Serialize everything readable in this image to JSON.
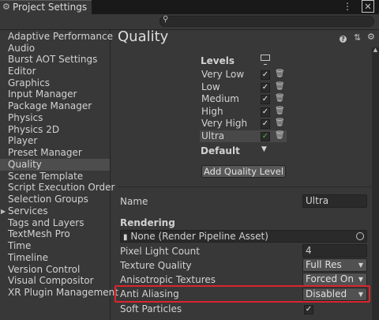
{
  "window": {
    "title": "Project Settings",
    "icons": [
      "gear-icon",
      "kebab-menu-icon",
      "close-icon"
    ]
  },
  "search": {
    "placeholder": "",
    "icon": "search-icon"
  },
  "sidebar": {
    "items": [
      {
        "label": "Adaptive Performance"
      },
      {
        "label": "Audio"
      },
      {
        "label": "Burst AOT Settings"
      },
      {
        "label": "Editor"
      },
      {
        "label": "Graphics"
      },
      {
        "label": "Input Manager"
      },
      {
        "label": "Package Manager"
      },
      {
        "label": "Physics"
      },
      {
        "label": "Physics 2D"
      },
      {
        "label": "Player"
      },
      {
        "label": "Preset Manager"
      },
      {
        "label": "Quality",
        "selected": true
      },
      {
        "label": "Scene Template"
      },
      {
        "label": "Script Execution Order"
      },
      {
        "label": "Selection Groups"
      },
      {
        "label": "Services",
        "expandable": true
      },
      {
        "label": "Tags and Layers"
      },
      {
        "label": "TextMesh Pro"
      },
      {
        "label": "Time"
      },
      {
        "label": "Timeline"
      },
      {
        "label": "Version Control"
      },
      {
        "label": "Visual Compositor"
      },
      {
        "label": "XR Plugin Management"
      }
    ]
  },
  "main": {
    "title": "Quality",
    "header_icons": [
      "help-icon",
      "presets-icon",
      "settings-gear-icon"
    ],
    "levels": {
      "title": "Levels",
      "rows": [
        {
          "name": "Very Low",
          "enabled": true
        },
        {
          "name": "Low",
          "enabled": true
        },
        {
          "name": "Medium",
          "enabled": true
        },
        {
          "name": "High",
          "enabled": true
        },
        {
          "name": "Very High",
          "enabled": true
        },
        {
          "name": "Ultra",
          "enabled": true,
          "selected": true,
          "default": true
        }
      ],
      "default_label": "Default",
      "add_button": "Add Quality Level"
    },
    "name_label": "Name",
    "name_value": "Ultra",
    "rendering_header": "Rendering",
    "render_pipeline": "None (Render Pipeline Asset)",
    "properties": [
      {
        "label": "Pixel Light Count",
        "value": "4",
        "kind": "field"
      },
      {
        "label": "Texture Quality",
        "value": "Full Res",
        "kind": "dropdown"
      },
      {
        "label": "Anisotropic Textures",
        "value": "Forced On",
        "kind": "dropdown"
      },
      {
        "label": "Anti Aliasing",
        "value": "Disabled",
        "kind": "dropdown",
        "highlighted": true
      },
      {
        "label": "Soft Particles",
        "value": "",
        "kind": "checkbox",
        "checked": true
      }
    ]
  },
  "colors": {
    "background": "#383838",
    "highlight_border": "#d9252c",
    "default_check": "#48b548"
  }
}
